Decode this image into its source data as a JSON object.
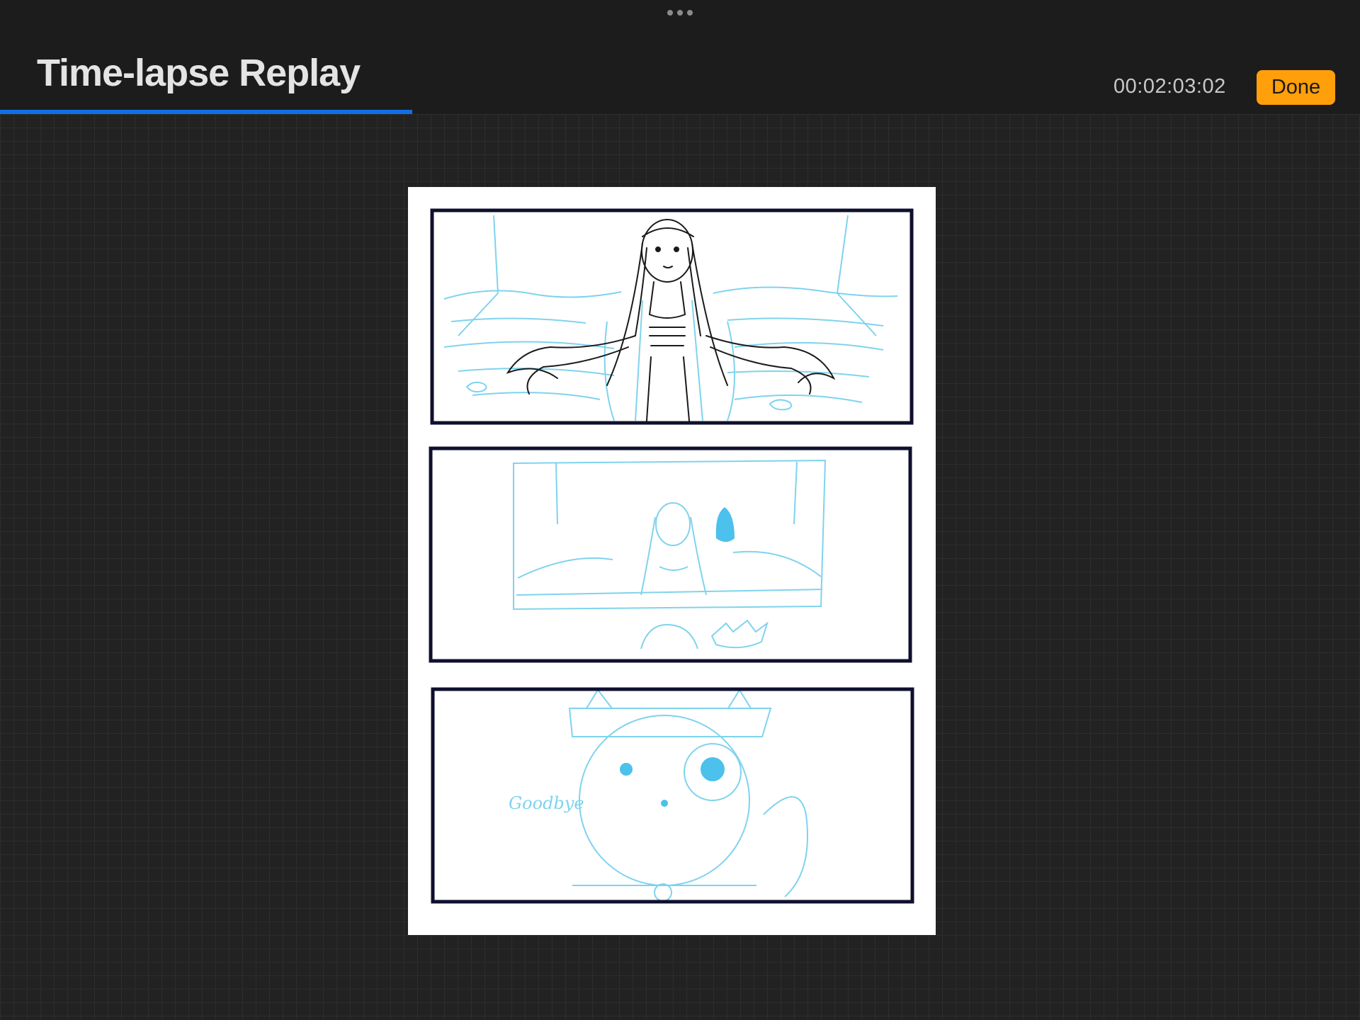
{
  "app": {
    "title": "Time-lapse Replay",
    "timecode": "00:02:03:02",
    "done_label": "Done"
  },
  "playback": {
    "progress_fraction": 0.303
  },
  "icons": {
    "more_menu": "more-dots-icon"
  },
  "colors": {
    "accent": "#ff9f0a",
    "progress": "#1270e3",
    "sketch_blue": "#7fd3ee",
    "ink": "#0f0f2e"
  },
  "canvas": {
    "panel_3_handwriting": "Goodbye"
  }
}
